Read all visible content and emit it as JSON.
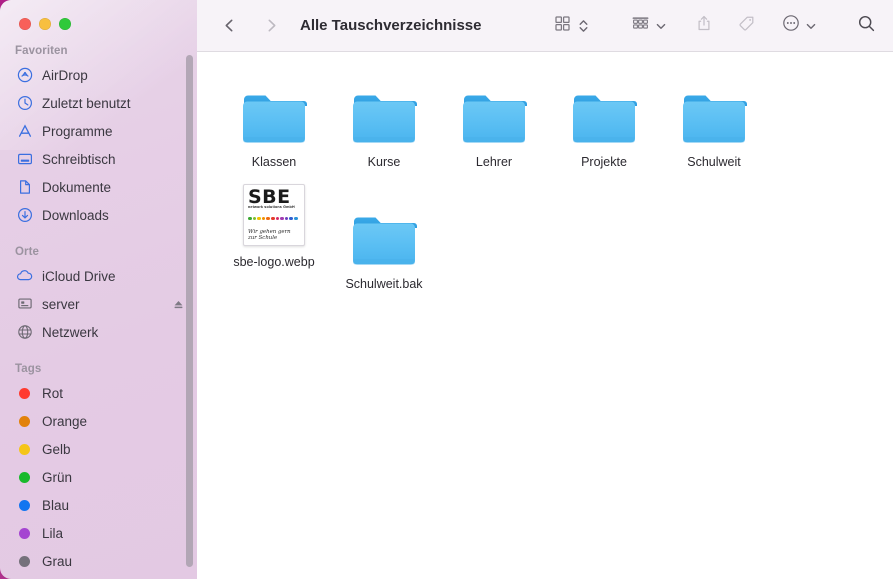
{
  "window": {
    "title": "Alle Tauschverzeichnisse",
    "traffic_lights": {
      "close": "close-button",
      "minimize": "minimize-button",
      "maximize": "maximize-button"
    }
  },
  "toolbar": {
    "back_label": "Zurück",
    "forward_label": "Vorwärts",
    "view_label": "Darstellung",
    "group_label": "Gruppieren",
    "share_label": "Teilen",
    "tag_label": "Tags",
    "more_label": "Mehr",
    "search_label": "Suchen"
  },
  "sidebar": {
    "sections": [
      {
        "header": "Favoriten",
        "items": [
          {
            "label": "AirDrop",
            "icon": "airdrop-icon"
          },
          {
            "label": "Zuletzt benutzt",
            "icon": "clock-icon"
          },
          {
            "label": "Programme",
            "icon": "applications-icon"
          },
          {
            "label": "Schreibtisch",
            "icon": "desktop-icon"
          },
          {
            "label": "Dokumente",
            "icon": "document-icon"
          },
          {
            "label": "Downloads",
            "icon": "download-icon"
          }
        ]
      },
      {
        "header": "Orte",
        "items": [
          {
            "label": "iCloud Drive",
            "icon": "cloud-icon"
          },
          {
            "label": "server",
            "icon": "server-icon",
            "eject": true
          },
          {
            "label": "Netzwerk",
            "icon": "network-icon"
          }
        ]
      },
      {
        "header": "Tags",
        "items": [
          {
            "label": "Rot",
            "color": "#ff3b30"
          },
          {
            "label": "Orange",
            "color": "#e2820b"
          },
          {
            "label": "Gelb",
            "color": "#f5c518"
          },
          {
            "label": "Grün",
            "color": "#19b92c"
          },
          {
            "label": "Blau",
            "color": "#1175f0"
          },
          {
            "label": "Lila",
            "color": "#a545d1"
          },
          {
            "label": "Grau",
            "color": "#75717b"
          }
        ]
      }
    ]
  },
  "files": [
    {
      "name": "Klassen",
      "type": "folder"
    },
    {
      "name": "Kurse",
      "type": "folder"
    },
    {
      "name": "Lehrer",
      "type": "folder"
    },
    {
      "name": "Projekte",
      "type": "folder"
    },
    {
      "name": "Schulweit",
      "type": "folder"
    },
    {
      "name": "sbe-logo.webp",
      "type": "image"
    },
    {
      "name": "Schulweit.bak",
      "type": "folder"
    }
  ],
  "logo": {
    "word": "SBE",
    "subtitle": "network solutions GmbH",
    "tagline_line1": "Wir gehen gern",
    "tagline_line2": "zur Schule",
    "dot_colors": [
      "#3aa832",
      "#7fbf2a",
      "#f2c200",
      "#f09000",
      "#ef6b12",
      "#e43b2a",
      "#d62a6a",
      "#a23bb0",
      "#6b3fbf",
      "#2f5fd0",
      "#2b93d8"
    ]
  },
  "colors": {
    "sidebar_bg": "#e4cbe4",
    "toolbar_bg": "#f7f3f8",
    "folder_blue": "#4fb8ef",
    "accent_blue": "#3b6fe0",
    "desktop_magenta": "#c2359c"
  }
}
